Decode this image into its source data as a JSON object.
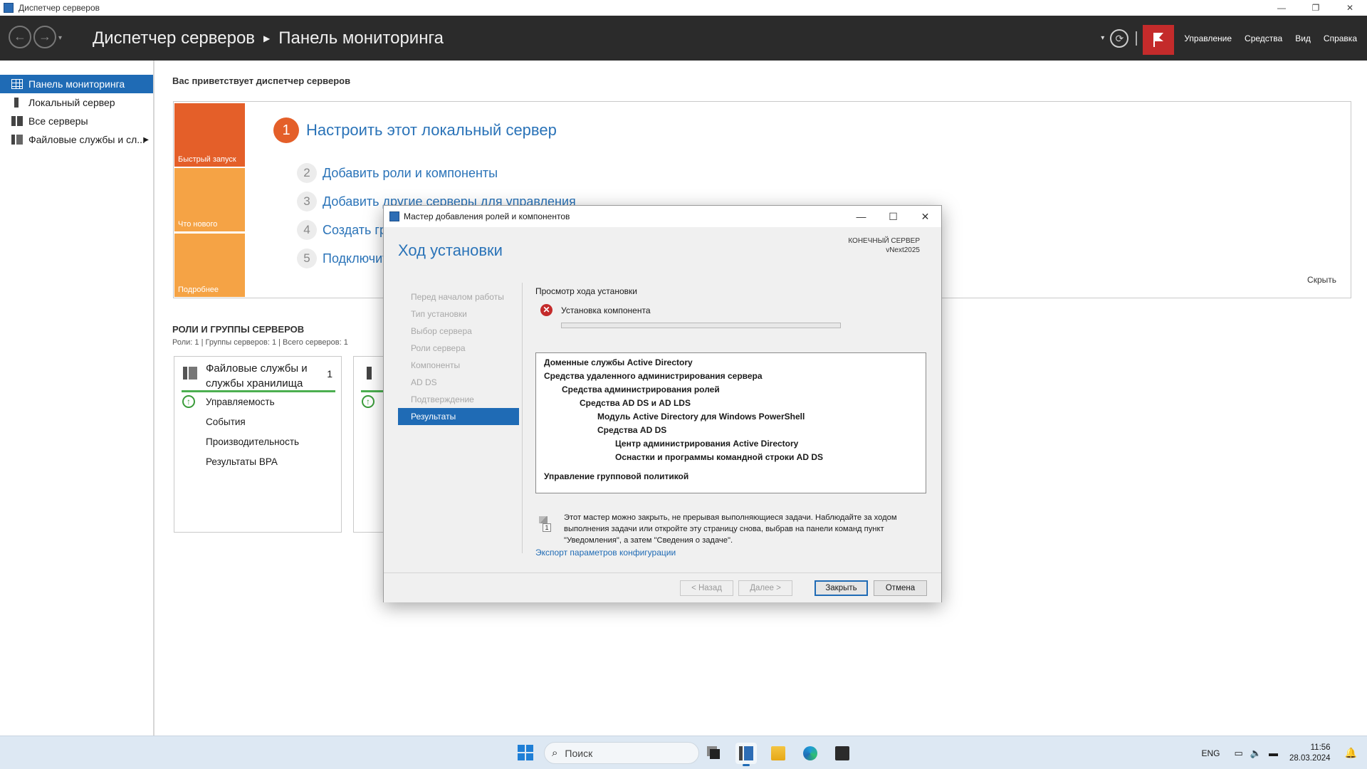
{
  "window": {
    "title": "Диспетчер серверов",
    "controls": {
      "minimize": "—",
      "restore": "❐",
      "close": "✕"
    }
  },
  "header": {
    "breadcrumb_root": "Диспетчер серверов",
    "breadcrumb_current": "Панель мониторинга",
    "menu": [
      "Управление",
      "Средства",
      "Вид",
      "Справка"
    ]
  },
  "sidebar": {
    "items": [
      {
        "label": "Панель мониторинга",
        "icon": "dashboard-icon",
        "active": true
      },
      {
        "label": "Локальный сервер",
        "icon": "server-icon"
      },
      {
        "label": "Все серверы",
        "icon": "servers-icon"
      },
      {
        "label": "Файловые службы и сл...",
        "icon": "file-services-icon",
        "has_arrow": true
      }
    ]
  },
  "dashboard": {
    "welcome": "Вас приветствует диспетчер серверов",
    "tiles": [
      "Быстрый запуск",
      "Что нового",
      "Подробнее"
    ],
    "steps": [
      {
        "num": "1",
        "label": "Настроить этот локальный сервер"
      },
      {
        "num": "2",
        "label": "Добавить роли и компоненты"
      },
      {
        "num": "3",
        "label": "Добавить другие серверы для управления"
      },
      {
        "num": "4",
        "label": "Создать группу серверов"
      },
      {
        "num": "5",
        "label": "Подключить этот сервер к облачным службам"
      }
    ],
    "hide_label": "Скрыть",
    "roles_title": "РОЛИ И ГРУППЫ СЕРВЕРОВ",
    "roles_subtitle": "Роли: 1 | Группы серверов: 1 | Всего серверов: 1",
    "role_card": {
      "title": "Файловые службы и службы хранилища",
      "count": "1",
      "rows": [
        "Управляемость",
        "События",
        "Производительность",
        "Результаты BPA"
      ]
    }
  },
  "dialog": {
    "title": "Мастер добавления ролей и компонентов",
    "heading": "Ход установки",
    "target_label": "КОНЕЧНЫЙ СЕРВЕР",
    "target_value": "vNext2025",
    "steps": [
      "Перед началом работы",
      "Тип установки",
      "Выбор сервера",
      "Роли сервера",
      "Компоненты",
      "AD DS",
      "Подтверждение",
      "Результаты"
    ],
    "active_step": 7,
    "progress_label": "Просмотр хода установки",
    "status_text": "Установка компонента",
    "progress_fraction": 0,
    "features": [
      {
        "label": "Доменные службы Active Directory",
        "level": 0
      },
      {
        "label": "Средства удаленного администрирования сервера",
        "level": 0
      },
      {
        "label": "Средства администрирования ролей",
        "level": 1
      },
      {
        "label": "Средства AD DS и AD LDS",
        "level": 2
      },
      {
        "label": "Модуль Active Directory для Windows PowerShell",
        "level": 3
      },
      {
        "label": "Средства AD DS",
        "level": 3
      },
      {
        "label": "Центр администрирования Active Directory",
        "level": 4
      },
      {
        "label": "Оснастки и программы командной строки AD DS",
        "level": 4
      },
      {
        "label": "Управление групповой политикой",
        "level": 0
      }
    ],
    "note": "Этот мастер можно закрыть, не прерывая выполняющиеся задачи. Наблюдайте за ходом выполнения задачи или откройте эту страницу снова, выбрав на панели команд пункт \"Уведомления\", а затем \"Сведения о задаче\".",
    "note_badge": "1",
    "export_link": "Экспорт параметров конфигурации",
    "buttons": {
      "back": "< Назад",
      "next": "Далее >",
      "close": "Закрыть",
      "cancel": "Отмена"
    }
  },
  "taskbar": {
    "search_placeholder": "Поиск",
    "lang": "ENG",
    "time": "11:56",
    "date": "28.03.2024"
  },
  "colors": {
    "accent": "#1f6bb5",
    "header_bg": "#2b2b2b",
    "quickstart_tile": "#e45f29",
    "tile_light": "#f5a345",
    "error": "#c42b2b"
  }
}
